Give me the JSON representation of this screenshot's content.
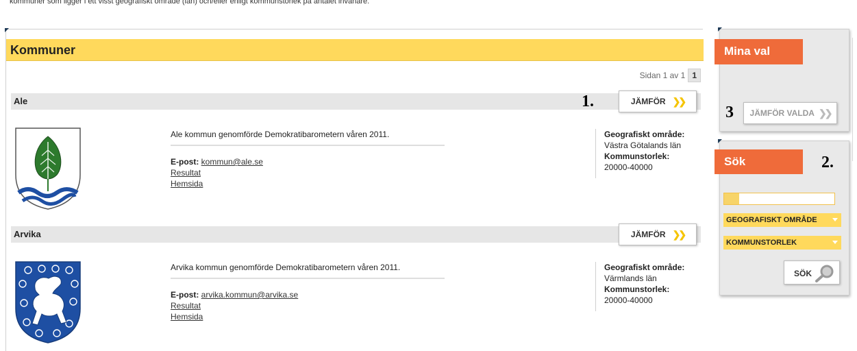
{
  "intro_text": "kommuner som ligger i ett visst geografiskt område (län) och/eller enligt kommunstorlek på antalet invånare.",
  "main": {
    "title": "Kommuner",
    "pager_text": "Sidan 1 av 1",
    "pager_current": "1"
  },
  "annotations": {
    "one": "1.",
    "two": "2.",
    "three": "3"
  },
  "labels": {
    "compare": "JÄMFÖR",
    "email": "E-post:",
    "geo": "Geografiskt område:",
    "size": "Kommunstorlek:"
  },
  "municipalities": [
    {
      "name": "Ale",
      "description": "Ale kommun genomförde Demokratibarometern våren 2011.",
      "email": "kommun@ale.se",
      "result_link": "Resultat",
      "home_link": "Hemsida",
      "region": "Västra Götalands län",
      "size": "20000-40000"
    },
    {
      "name": "Arvika",
      "description": "Arvika kommun genomförde Demokratibarometern våren 2011.",
      "email": "arvika.kommun@arvika.se",
      "result_link": "Resultat",
      "home_link": "Hemsida",
      "region": "Värmlands län",
      "size": "20000-40000"
    }
  ],
  "sidebar": {
    "mina_val_title": "Mina val",
    "compare_selected": "JÄMFÖR VALDA",
    "search_title": "Sök",
    "geo_select": "GEOGRAFISKT OMRÅDE",
    "size_select": "KOMMUNSTORLEK",
    "search_button": "SÖK"
  },
  "colors": {
    "header_yellow": "#ffd95c",
    "orange": "#ef6b3a",
    "chevron": "#f5c400",
    "crest_blue": "#1e4fa3"
  }
}
